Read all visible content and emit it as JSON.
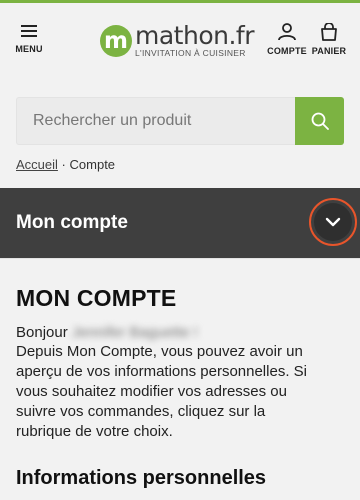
{
  "header": {
    "menu_label": "MENU",
    "logo": {
      "mark": "m",
      "name": "mathon.fr",
      "tagline": "L'INVITATION À CUISINER"
    },
    "account_label": "COMPTE",
    "cart_label": "PANIER"
  },
  "search": {
    "placeholder": "Rechercher un produit"
  },
  "breadcrumb": {
    "home": "Accueil",
    "separator": "·",
    "current": "Compte"
  },
  "account_bar": {
    "title": "Mon compte"
  },
  "main": {
    "title": "MON COMPTE",
    "greeting": "Bonjour",
    "user_name": "Jennifer Baguette !",
    "description": "Depuis Mon Compte, vous pouvez avoir un aperçu de vos informations personnelles. Si vous souhaitez modifier vos adresses ou suivre vos commandes, cliquez sur la rubrique de votre choix.",
    "section_title": "Informations personnelles"
  },
  "colors": {
    "brand_green": "#7cb342",
    "dark_bar": "#3f3f3f",
    "focus_ring": "#e8552b"
  }
}
